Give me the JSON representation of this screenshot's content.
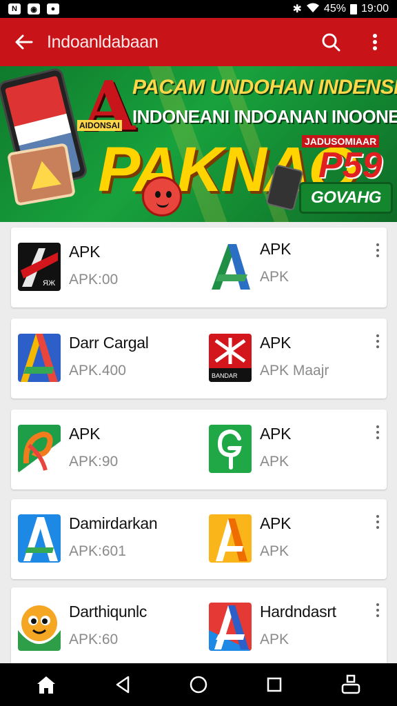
{
  "status_bar": {
    "left_icons": [
      "notification-n-icon",
      "camera-icon",
      "chat-icon"
    ],
    "battery_text": "45%",
    "time": "19:00"
  },
  "app_bar": {
    "title": "Indoanldabaan",
    "background": "#c81419",
    "icons": [
      "back-arrow-icon",
      "search-icon",
      "overflow-menu-icon"
    ]
  },
  "banner": {
    "emblem_letter": "A",
    "emblem_caption": "AIDONSAI",
    "line1": "PACAM UNDOHAN INDENSIA",
    "line2": "INDONEANI INDOANAN INOONESIA",
    "brand": "PAKNAO",
    "promo_small": "JADUSOMIAAR",
    "price": "P59",
    "cta": "GOVAHG"
  },
  "apps": [
    {
      "left": {
        "name": "APK",
        "meta": "APK:00",
        "icon": "red-arrow-app-icon"
      },
      "right": {
        "name": "APK",
        "meta": "APK",
        "icon": "green-blue-a-app-icon"
      }
    },
    {
      "left": {
        "name": "Darr Cargal",
        "meta": "APK.400",
        "icon": "multicolor-a-app-icon"
      },
      "right": {
        "name": "APK",
        "meta": "APK Maajr",
        "icon": "red-star-app-icon"
      }
    },
    {
      "left": {
        "name": "APK",
        "meta": "APK:90",
        "icon": "green-orange-app-icon"
      },
      "right": {
        "name": "APK",
        "meta": "APK",
        "icon": "green-g-app-icon"
      }
    },
    {
      "left": {
        "name": "Damirdarkan",
        "meta": "APK:601",
        "icon": "blue-a-app-icon"
      },
      "right": {
        "name": "APK",
        "meta": "APK",
        "icon": "yellow-a-app-icon"
      }
    },
    {
      "left": {
        "name": "Darthiqunlc",
        "meta": "APK:60",
        "icon": "mascot-app-icon"
      },
      "right": {
        "name": "Hardndasrt",
        "meta": "APK",
        "icon": "red-blue-a-app-icon"
      }
    }
  ],
  "nav_bar": {
    "icons": [
      "home-icon",
      "back-triangle-icon",
      "home-circle-icon",
      "recents-square-icon",
      "profile-icon"
    ]
  }
}
